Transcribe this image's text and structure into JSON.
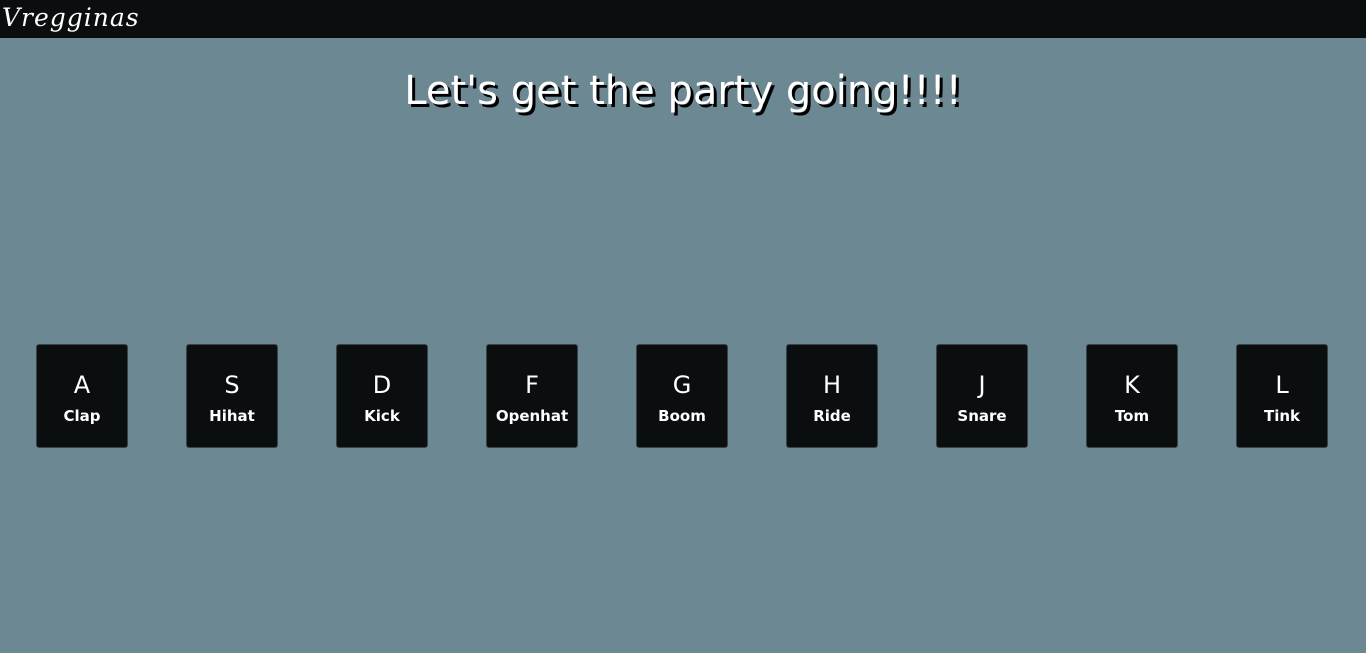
{
  "header": {
    "brand": "Vregginas"
  },
  "main": {
    "headline": "Let's get the party going!!!!"
  },
  "drum_keys": [
    {
      "key": "A",
      "sound": "Clap"
    },
    {
      "key": "S",
      "sound": "Hihat"
    },
    {
      "key": "D",
      "sound": "Kick"
    },
    {
      "key": "F",
      "sound": "Openhat"
    },
    {
      "key": "G",
      "sound": "Boom"
    },
    {
      "key": "H",
      "sound": "Ride"
    },
    {
      "key": "J",
      "sound": "Snare"
    },
    {
      "key": "K",
      "sound": "Tom"
    },
    {
      "key": "L",
      "sound": "Tink"
    }
  ],
  "colors": {
    "background": "#6c8893",
    "topbar": "#0b0e0e",
    "key_background": "#0b0e0e",
    "text": "#ffffff"
  }
}
